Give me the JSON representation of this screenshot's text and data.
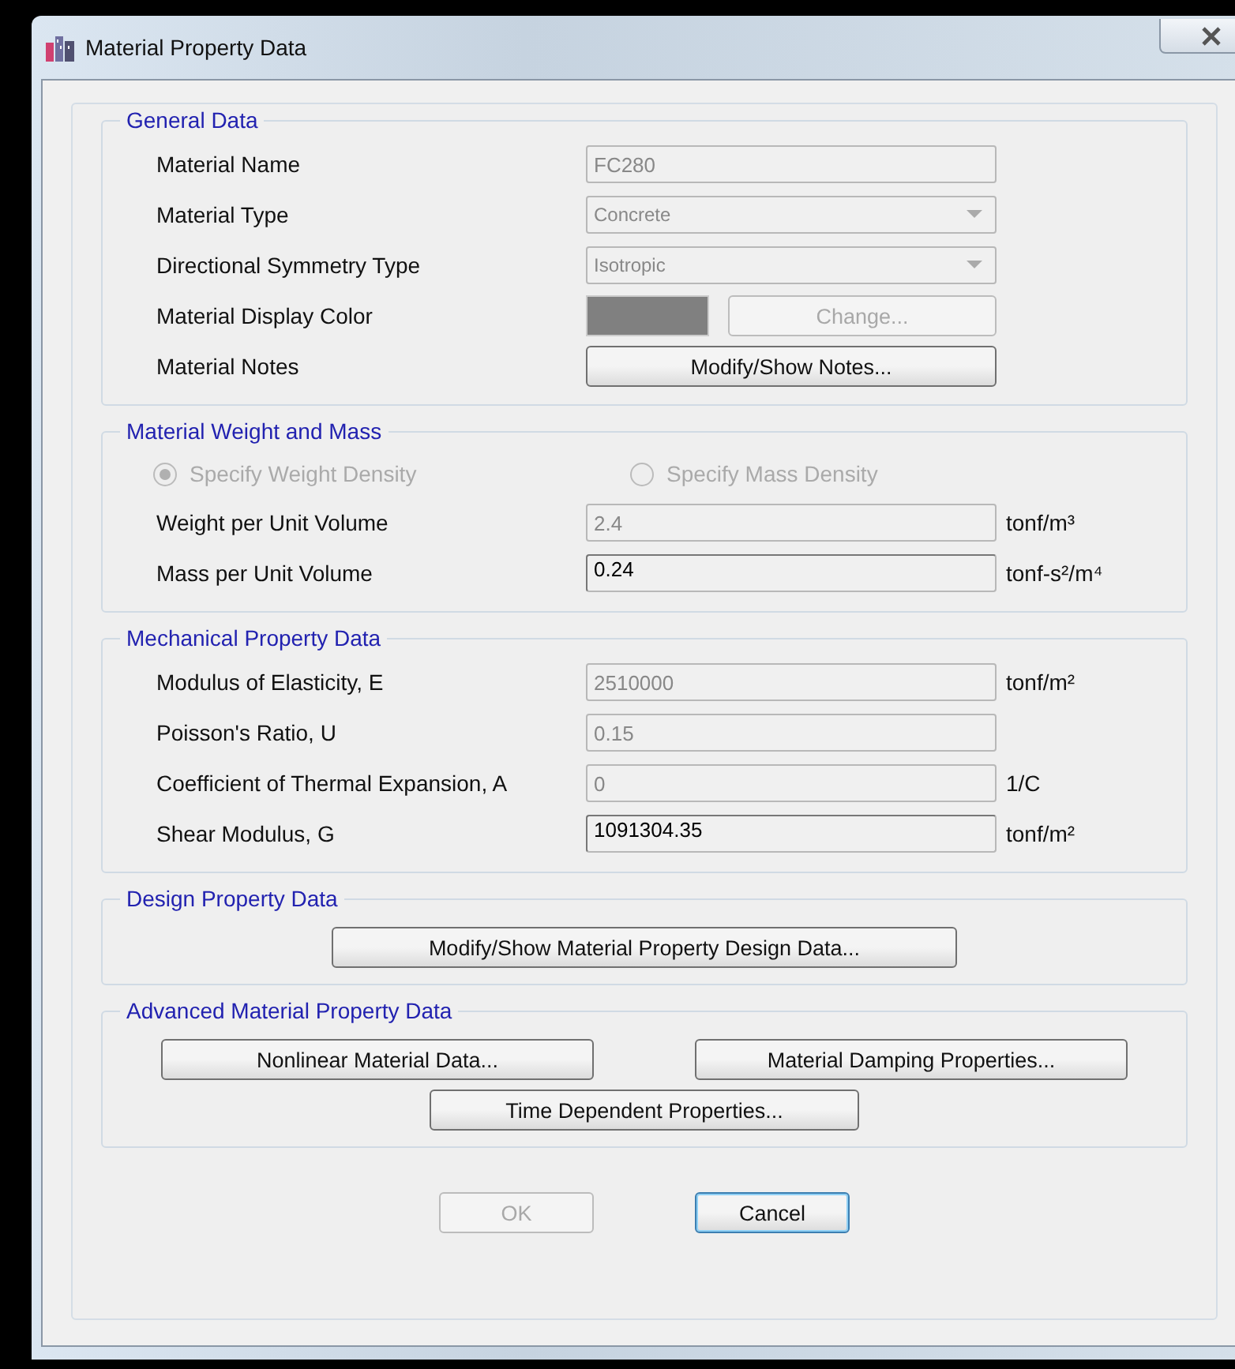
{
  "window": {
    "title": "Material Property Data"
  },
  "sections": [
    {
      "kind": "rows",
      "title": "General Data",
      "rows": [
        {
          "kind": "text",
          "label": "Material Name",
          "value": "FC280",
          "disabled": true
        },
        {
          "kind": "combo",
          "label": "Material Type",
          "value": "Concrete",
          "disabled": true
        },
        {
          "kind": "combo",
          "label": "Directional Symmetry Type",
          "value": "Isotropic",
          "disabled": true
        },
        {
          "kind": "color",
          "label": "Material Display Color",
          "color": "#808080",
          "button": {
            "label": "Change...",
            "disabled": true
          }
        },
        {
          "kind": "button",
          "label": "Material Notes",
          "button": {
            "label": "Modify/Show Notes...",
            "disabled": false
          }
        }
      ]
    },
    {
      "kind": "rows",
      "title": "Material Weight and Mass",
      "radios": [
        {
          "label": "Specify Weight Density",
          "selected": true,
          "disabled": true
        },
        {
          "label": "Specify Mass Density",
          "selected": false,
          "disabled": true
        }
      ],
      "rows": [
        {
          "kind": "text",
          "label": "Weight per Unit Volume",
          "value": "2.4",
          "disabled": true,
          "unit": "tonf/m³"
        },
        {
          "kind": "text",
          "label": "Mass per Unit Volume",
          "value": "0.24",
          "disabled": false,
          "unit": "tonf-s²/m⁴"
        }
      ]
    },
    {
      "kind": "rows",
      "title": "Mechanical Property Data",
      "rows": [
        {
          "kind": "text",
          "label": "Modulus of Elasticity,  E",
          "value": "2510000",
          "disabled": true,
          "unit": "tonf/m²"
        },
        {
          "kind": "text",
          "label": "Poisson's Ratio,  U",
          "value": "0.15",
          "disabled": true
        },
        {
          "kind": "text",
          "label": "Coefficient of Thermal Expansion,  A",
          "value": "0",
          "disabled": true,
          "unit": "1/C"
        },
        {
          "kind": "text",
          "label": "Shear Modulus,  G",
          "value": "1091304.35",
          "disabled": false,
          "unit": "tonf/m²"
        }
      ]
    },
    {
      "kind": "buttons",
      "title": "Design Property Data",
      "buttons": [
        {
          "label": "Modify/Show Material Property Design Data...",
          "disabled": false
        }
      ]
    },
    {
      "kind": "buttons",
      "title": "Advanced Material Property Data",
      "buttons": [
        {
          "label": "Nonlinear Material Data...",
          "disabled": false
        },
        {
          "label": "Material Damping Properties...",
          "disabled": false
        },
        {
          "label": "Time Dependent Properties...",
          "disabled": false
        }
      ]
    }
  ],
  "footer": [
    {
      "label": "OK",
      "disabled": true,
      "default": false
    },
    {
      "label": "Cancel",
      "disabled": false,
      "default": true
    }
  ]
}
